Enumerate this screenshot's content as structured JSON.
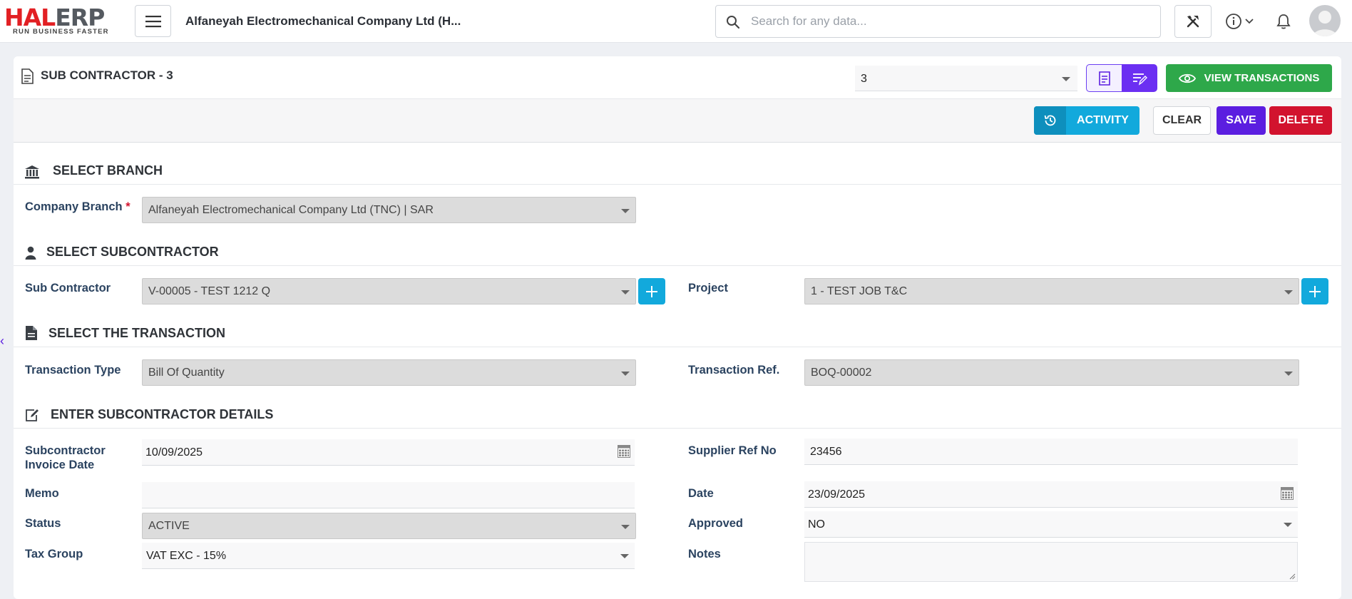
{
  "brand": {
    "logo_main_red": "HAL",
    "logo_main_grey": "ERP",
    "tagline": "RUN BUSINESS FASTER"
  },
  "header": {
    "company": "Alfaneyah Electromechanical Company Ltd (H...",
    "search_placeholder": "Search for any data..."
  },
  "document": {
    "title": "SUB CONTRACTOR - 3",
    "record_number": "3",
    "view_transactions_label": "VIEW TRANSACTIONS"
  },
  "actions": {
    "activity_label": "ACTIVITY",
    "clear_label": "CLEAR",
    "save_label": "SAVE",
    "delete_label": "DELETE"
  },
  "sections": {
    "branch": "SELECT BRANCH",
    "subcontractor": "SELECT SUBCONTRACTOR",
    "transaction": "SELECT THE TRANSACTION",
    "details": "ENTER SUBCONTRACTOR DETAILS"
  },
  "fields": {
    "company_branch": {
      "label": "Company Branch",
      "required_mark": "*",
      "value": "Alfaneyah Electromechanical Company Ltd (TNC) | SAR"
    },
    "sub_contractor": {
      "label": "Sub Contractor",
      "value": "V-00005 - TEST 1212 Q"
    },
    "project": {
      "label": "Project",
      "value": "1 - TEST JOB T&C"
    },
    "transaction_type": {
      "label": "Transaction Type",
      "value": "Bill Of Quantity"
    },
    "transaction_ref": {
      "label": "Transaction Ref.",
      "value": "BOQ-00002"
    },
    "invoice_date": {
      "label_line1": "Subcontractor",
      "label_line2": "Invoice Date",
      "value": "10/09/2025"
    },
    "supplier_ref": {
      "label": "Supplier Ref No",
      "value": "23456"
    },
    "memo": {
      "label": "Memo",
      "value": ""
    },
    "date": {
      "label": "Date",
      "value": "23/09/2025"
    },
    "status": {
      "label": "Status",
      "value": "ACTIVE"
    },
    "approved": {
      "label": "Approved",
      "value": "NO"
    },
    "tax_group": {
      "label": "Tax Group",
      "value": "VAT EXC - 15%"
    },
    "notes": {
      "label": "Notes",
      "value": ""
    }
  },
  "colors": {
    "primary_purple": "#5b1ee0",
    "info_blue": "#12a9dc",
    "success_green": "#2ea84a",
    "danger_red": "#d2132e",
    "label_navy": "#2b4360"
  }
}
